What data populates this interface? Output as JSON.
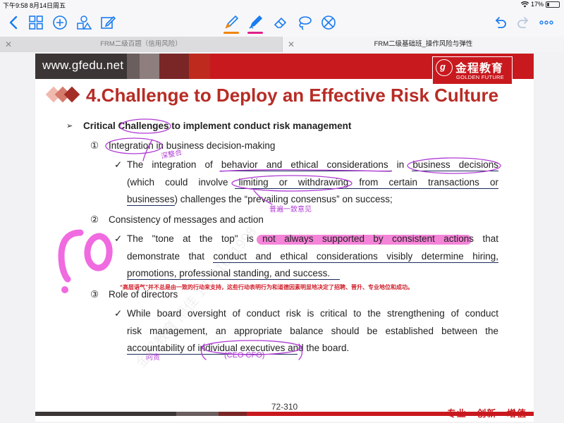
{
  "status_bar": {
    "time_date": "下午9:58   8月14日周五",
    "battery": "17%",
    "battery_level": 0.17
  },
  "toolbar": {
    "icons": [
      "back-icon",
      "grid-icon",
      "add-icon",
      "shapes-icon",
      "edit-icon",
      "pen-icon",
      "highlighter-icon",
      "eraser-icon",
      "lasso-icon",
      "no-touch-icon",
      "undo-icon",
      "redo-icon",
      "more-icon"
    ],
    "pen_color": "#f0850f",
    "highlighter_color": "#e0208a"
  },
  "tabs": [
    {
      "label": "FRM二级百题（信用风险）",
      "active": false
    },
    {
      "label": "FRM二级基础班_操作风险与弹性",
      "active": true
    }
  ],
  "slide": {
    "site": "www.gfedu.net",
    "logo_cn": "金程教育",
    "logo_en": "GOLDEN FUTURE",
    "logo_seal": "g",
    "title": "4.Challenge to Deploy an Effective Risk Culture",
    "bullet_heading": "Critical Challenges to implement conduct risk management",
    "items": [
      {
        "num": "①",
        "heading": "Integration in business decision-making",
        "lines": [
          "The integration of behavior and ethical considerations in business decisions",
          "(which could involve limiting or withdrawing from certain transactions or",
          "businesses) challenges the “prevailing consensus” on success;"
        ]
      },
      {
        "num": "②",
        "heading": "Consistency of messages and action",
        "lines": [
          "The \"tone at the top\" is not always supported by consistent actions that",
          "demonstrate that conduct and ethical considerations visibly determine hiring,",
          "promotions, professional standing, and success."
        ]
      },
      {
        "num": "③",
        "heading": "Role of directors",
        "lines": [
          "While board oversight of conduct risk is critical to the strengthening of conduct",
          "risk management, an appropriate balance should be established between the",
          "accountability of individual executives and the board."
        ]
      }
    ],
    "chinese_note": "“高层语气”并不总是由一致的行动来支持，这些行动表明行为和道德因素明显地决定了招聘、晋升、专业地位和成功。",
    "page_number": "72-310",
    "slogan": "专业 · 创新 · 增值",
    "title_color": "#b72c25",
    "brand_red": "#c8191e"
  },
  "handwriting": {
    "note1": "深整合",
    "note2": "普遍一致意见",
    "note3": "问责",
    "note4": "(CEO CFO)",
    "big_mark": "ro"
  }
}
